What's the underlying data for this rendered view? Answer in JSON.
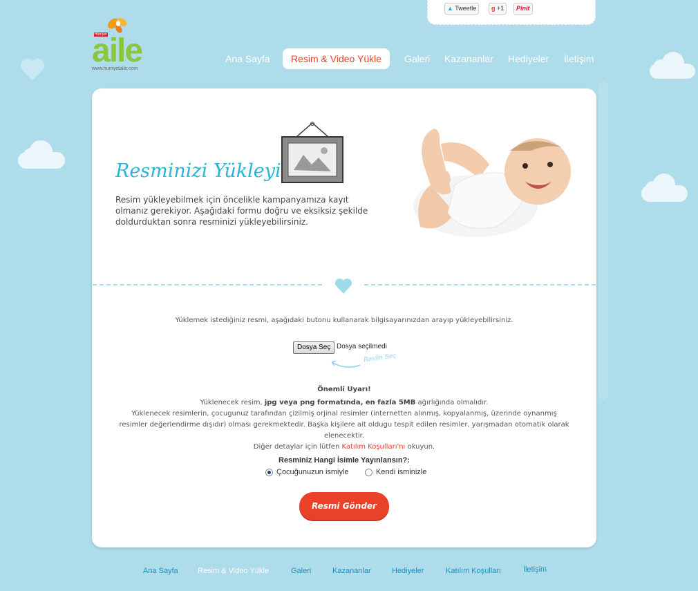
{
  "brand": {
    "logo_text": "aile",
    "logo_badge": "Hürriyet",
    "logo_url": "www.hurriyetaile.com"
  },
  "social": {
    "tweet": "Tweetle",
    "gplus": "+1",
    "pinit": "Pinit"
  },
  "nav": [
    {
      "label": "Ana Sayfa"
    },
    {
      "label": "Resim & Video Yükle",
      "active": true
    },
    {
      "label": "Galeri"
    },
    {
      "label": "Kazananlar"
    },
    {
      "label": "Hediyeler"
    },
    {
      "label": "İletişim"
    }
  ],
  "hero": {
    "title": "Resminizi Yükleyin",
    "intro": "Resim yükleyebilmek için öncelikle kampanyamıza kayıt olmanız gerekiyor. Aşağıdaki formu doğru ve eksiksiz şekilde doldurduktan sonra resminizi yükleyebilirsiniz."
  },
  "upload": {
    "instruction": "Yüklemek istediğiniz resmi, aşağıdaki butonu kullanarak bilgisayarınızdan arayıp yükleyebilirsiniz.",
    "file_button": "Dosya Seç",
    "file_status": "Dosya seçilmedi",
    "hint": "Resim Seç"
  },
  "warning": {
    "title": "Önemli Uyarı!",
    "line1_pre": "Yüklenecek resim, ",
    "line1_bold": "jpg veya png formatında, en fazla 5MB",
    "line1_post": " ağırlığında olmalıdır.",
    "line2": "Yüklenecek resimlerin, çocugunuz tarafından çizilmiş orjinal resimler (internetten alınmış, kopyalanmış, üzerinde oynanmış resimler değerlendirme dışıdır) olması gerekmektedir. Başka kişilere ait oldugu tespit edilen resimler, yarışmadan otomatik olarak elenecektir.",
    "line3_pre": "Diğer detaylar için lütfen ",
    "line3_link": "Katılım Koşulları'nı",
    "line3_post": " okuyun."
  },
  "publish": {
    "question": "Resminiz Hangi İsimle Yayınlansın?:",
    "options": [
      {
        "label": "Çocuğunuzun ismiyle",
        "selected": true
      },
      {
        "label": "Kendi isminizle",
        "selected": false
      }
    ]
  },
  "submit_label": "Resmi Gönder",
  "footer": [
    {
      "label": "Ana Sayfa",
      "color": "#1a8fbf"
    },
    {
      "label": "Resim & Video Yükle",
      "color": "#ffffff"
    },
    {
      "label": "Galeri",
      "color": "#1a8fbf"
    },
    {
      "label": "Kazananlar",
      "color": "#1a8fbf"
    },
    {
      "label": "Hediyeler",
      "color": "#1a8fbf"
    },
    {
      "label": "Katılım Koşulları",
      "color": "#1a8fbf"
    },
    {
      "label": "İletişim",
      "color": "#1a8fbf"
    }
  ],
  "colors": {
    "background": "#aedcea",
    "accent": "#ea4228",
    "title": "#29b5d6",
    "logo_green": "#8cc63f"
  }
}
